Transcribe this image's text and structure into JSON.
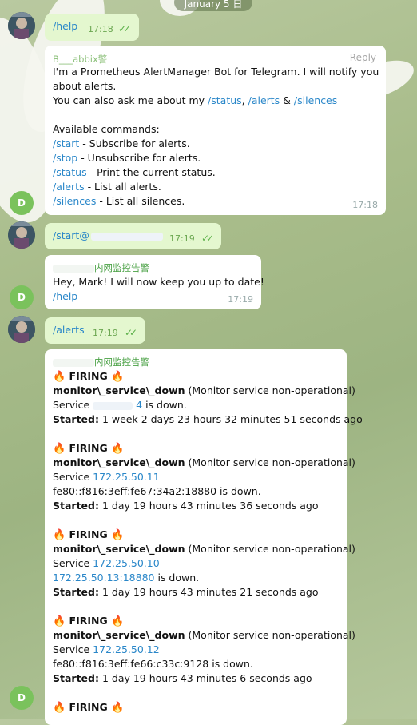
{
  "date_header": "January 5 日",
  "avatar_letter": "D",
  "reply_label": "Reply",
  "messages": {
    "m1": {
      "text": "/help",
      "time": "17:18",
      "ticks": "✓✓"
    },
    "m2": {
      "sender": "B___abbix警",
      "intro1": "I'm a Prometheus AlertManager Bot for Telegram. I will notify you",
      "intro2": "about alerts.",
      "ask_prefix": "You can also ask me about my ",
      "cmd_status": "/status",
      "sep1": ", ",
      "cmd_alerts": "/alerts",
      "sep2": " & ",
      "cmd_silences": "/silences",
      "available": "Available commands:",
      "commands": [
        {
          "cmd": "/start",
          "desc": " - Subscribe for alerts."
        },
        {
          "cmd": "/stop",
          "desc": " - Unsubscribe for alerts."
        },
        {
          "cmd": "/status",
          "desc": " - Print the current status."
        },
        {
          "cmd": "/alerts",
          "desc": " - List all alerts."
        },
        {
          "cmd": "/silences",
          "desc": " - List all silences."
        }
      ],
      "time": "17:18"
    },
    "m3": {
      "text": "/start@",
      "time": "17:19",
      "ticks": "✓✓"
    },
    "m4": {
      "sender": "内网监控告警",
      "text": "Hey, Mark! I will now keep you up to date!",
      "cmd": "/help",
      "time": "17:19"
    },
    "m5": {
      "text": "/alerts",
      "time": "17:19",
      "ticks": "✓✓"
    },
    "m6": {
      "sender": "内网监控告警",
      "firing": "FIRING",
      "fire_emoji": "🔥",
      "alert_name": "monitor\\_service\\_down",
      "alert_desc": " (Monitor service non-operational)",
      "service_word": "Service ",
      "is_down": " is down.",
      "started_label": "Started:",
      "alerts": [
        {
          "addr_link": "",
          "addr_plain": "",
          "started": " 1 week 2 days 23 hours 32 minutes 51 seconds ago"
        },
        {
          "addr_link": "172.25.50.11",
          "addr_line2": "fe80::f816:3eff:fe67:34a2:18880",
          "started": " 1 day 19 hours 43 minutes 36 seconds ago"
        },
        {
          "addr_link": "172.25.50.10",
          "addr_line2": "172.25.50.13:18880",
          "started": " 1 day 19 hours 43 minutes 21 seconds ago"
        },
        {
          "addr_link": "172.25.50.12",
          "addr_line2": "fe80::f816:3eff:fe66:c33c:9128",
          "started": " 1 day 19 hours 43 minutes 6 seconds ago"
        }
      ]
    }
  }
}
